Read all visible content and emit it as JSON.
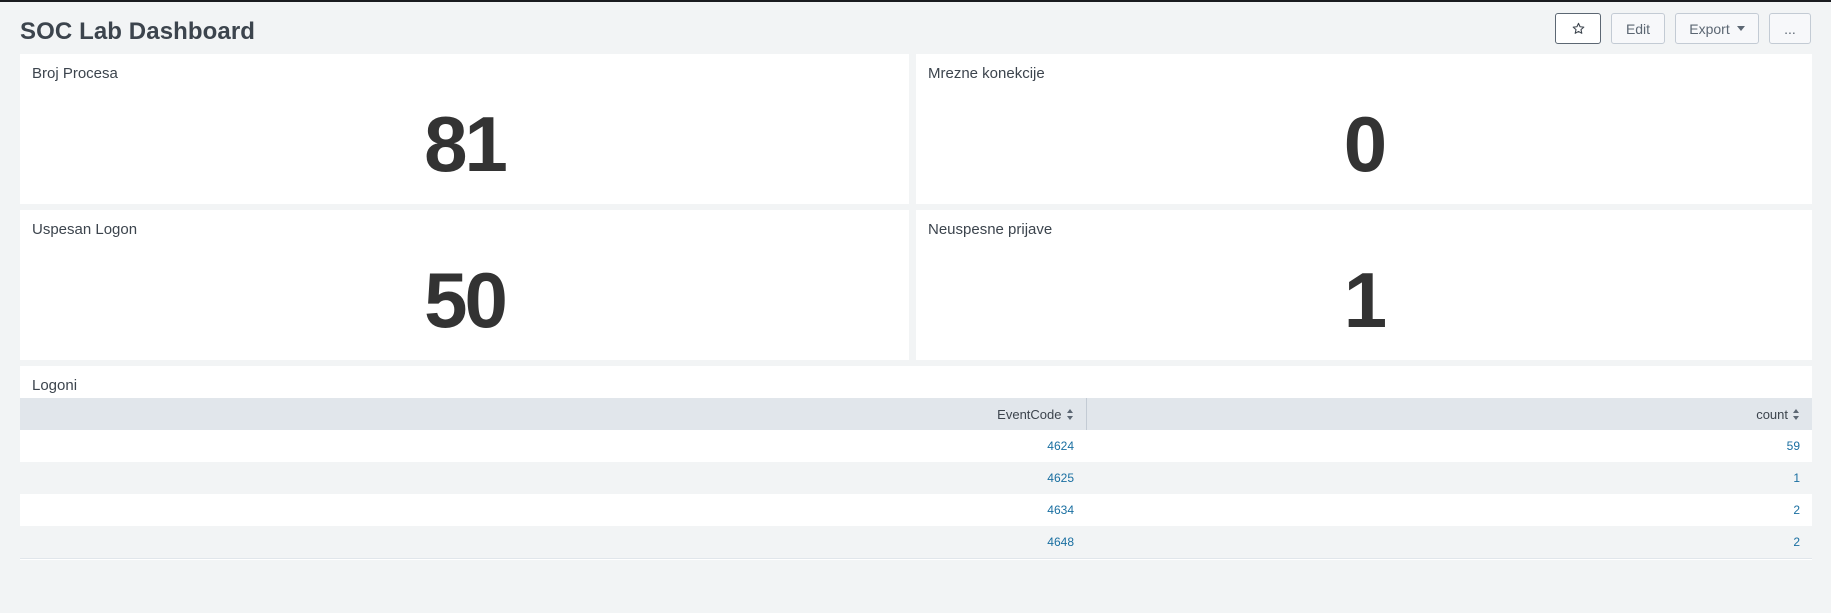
{
  "dashboard": {
    "title": "SOC Lab Dashboard",
    "actions": {
      "star_icon": "star-icon",
      "edit_label": "Edit",
      "export_label": "Export",
      "more_label": "..."
    }
  },
  "panels": [
    {
      "title": "Broj Procesa",
      "value": "81"
    },
    {
      "title": "Mrezne konekcije",
      "value": "0"
    },
    {
      "title": "Uspesan Logon",
      "value": "50"
    },
    {
      "title": "Neuspesne prijave",
      "value": "1"
    }
  ],
  "logons": {
    "title": "Logoni",
    "columns": [
      "EventCode",
      "count"
    ],
    "rows": [
      [
        "4624",
        "59"
      ],
      [
        "4625",
        "1"
      ],
      [
        "4634",
        "2"
      ],
      [
        "4648",
        "2"
      ]
    ]
  },
  "colors": {
    "background": "#f2f4f5",
    "panel": "#ffffff",
    "table_header": "#e1e6eb",
    "link": "#1a6fa1",
    "single_value": "#333333"
  }
}
